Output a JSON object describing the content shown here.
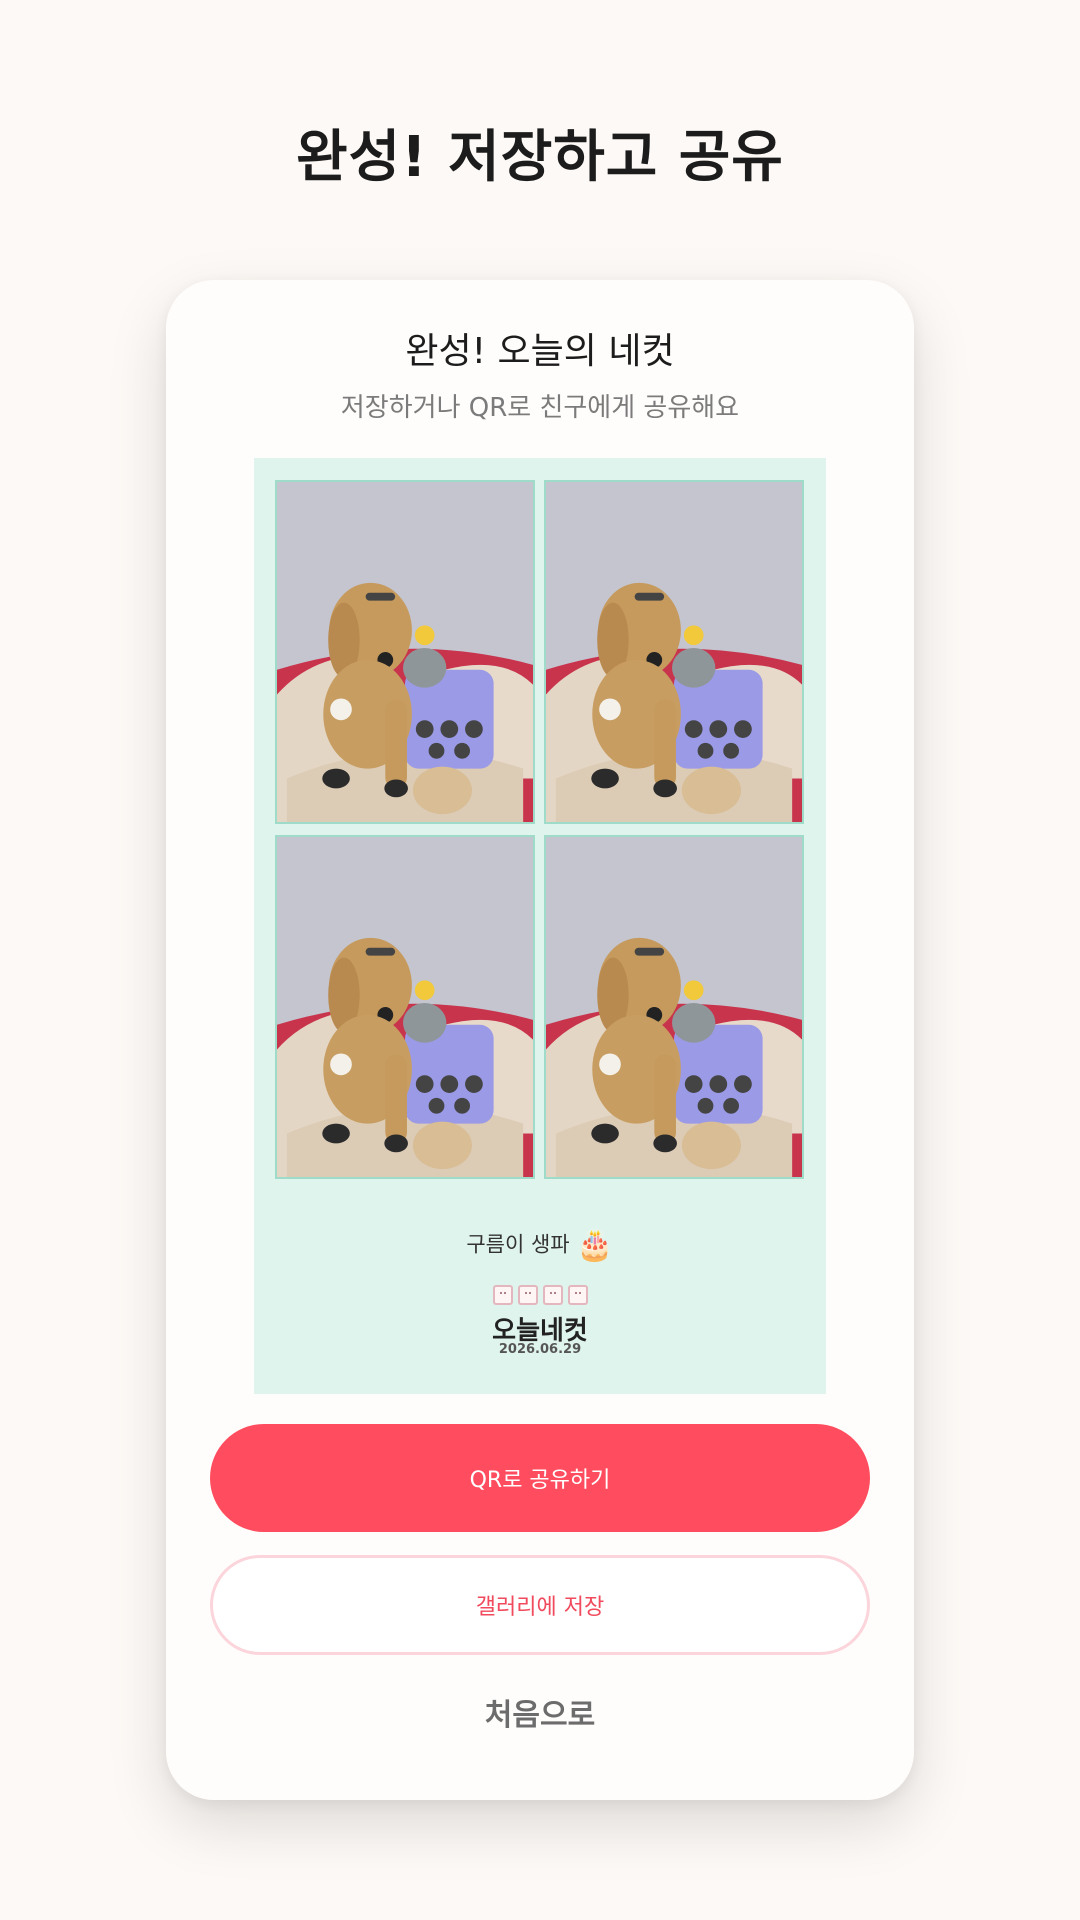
{
  "header": {
    "title": "완성! 저장하고 공유"
  },
  "card": {
    "title": "완성! 오늘의 네컷",
    "subtitle": "저장하거나 QR로 친구에게 공유해요"
  },
  "strip": {
    "caption": "구름이 생파",
    "caption_emoji": "🎂",
    "brand": {
      "name": "오늘네컷",
      "date": "2026.06.29"
    }
  },
  "actions": {
    "qr_share": "QR로 공유하기",
    "save_gallery": "갤러리에 저장",
    "go_home": "처음으로"
  },
  "colors": {
    "background": "#fdf9f6",
    "primary": "#ff4d5f",
    "strip_background": "#e0f4ee",
    "photo_border": "#9edbc8"
  }
}
